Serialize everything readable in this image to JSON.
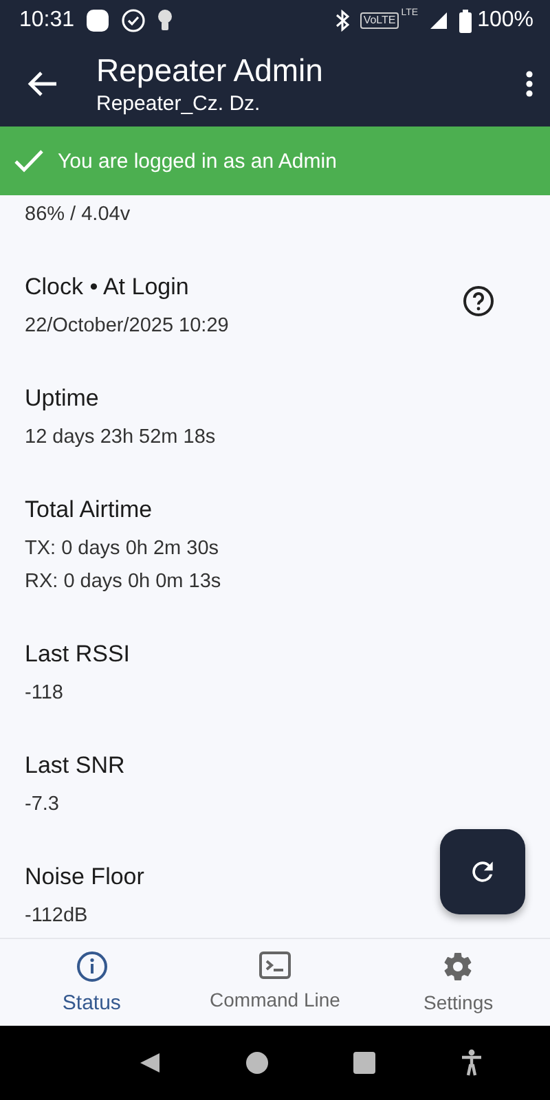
{
  "status_bar": {
    "time": "10:31",
    "network_badge": "VoLTE",
    "network_type": "LTE",
    "battery": "100%"
  },
  "app_bar": {
    "title": "Repeater Admin",
    "subtitle": "Repeater_Cz. Dz."
  },
  "banner": {
    "text": "You are logged in as an Admin"
  },
  "items": [
    {
      "kind": "plain",
      "values": [
        "86% / 4.04v"
      ]
    },
    {
      "kind": "help",
      "title": "Clock • At Login",
      "values": [
        "22/October/2025 10:29"
      ]
    },
    {
      "kind": "plain",
      "title": "Uptime",
      "values": [
        "12 days 23h 52m 18s"
      ]
    },
    {
      "kind": "plain",
      "title": "Total Airtime",
      "values": [
        "TX: 0 days 0h 2m 30s",
        "RX: 0 days 0h 0m 13s"
      ]
    },
    {
      "kind": "plain",
      "title": "Last RSSI",
      "values": [
        "-118"
      ]
    },
    {
      "kind": "plain",
      "title": "Last SNR",
      "values": [
        "-7.3"
      ]
    },
    {
      "kind": "plain",
      "title": "Noise Floor",
      "values": [
        "-112dB"
      ]
    }
  ],
  "bottom_nav": [
    {
      "kind": "info",
      "label": "Status",
      "selected": true
    },
    {
      "kind": "terminal",
      "label": "Command Line",
      "selected": false
    },
    {
      "kind": "gear",
      "label": "Settings",
      "selected": false
    }
  ]
}
